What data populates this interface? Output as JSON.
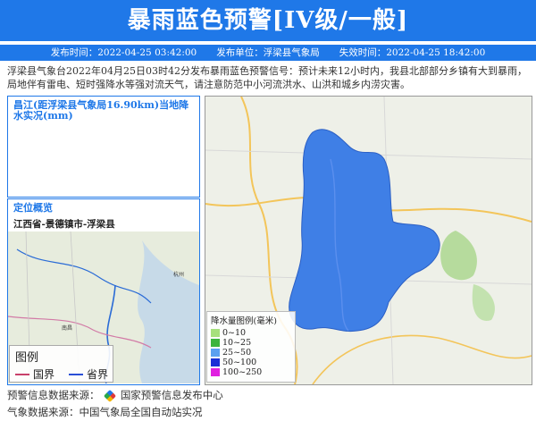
{
  "header": {
    "title": "暴雨蓝色预警[IV级/一般]",
    "publish_time": "发布时间：2022-04-25 03:42:00",
    "publisher": "发布单位：浮梁县气象局",
    "expire_time": "失效时间：2022-04-25 18:42:00"
  },
  "description": "浮梁县气象台2022年04月25日03时42分发布暴雨蓝色预警信号：预计未来12小时内，我县北部部分乡镇有大到暴雨，局地伴有雷电、短时强降水等强对流天气，请注意防范中小河流洪水、山洪和城乡内涝灾害。",
  "rain_panel": {
    "title": "昌江(距浮梁县气象局16.90km)当地降水实况(mm)"
  },
  "location_panel": {
    "title": "定位概览",
    "location": "江西省-景德镇市-浮梁县",
    "legend_title": "图例",
    "national_border": "国界",
    "provincial_border": "省界",
    "city_label": "杭州",
    "city_label_2": "南昌"
  },
  "map_legend": {
    "title": "降水量图例(毫米)",
    "items": [
      {
        "label": "0~10",
        "color": "#a6e07c"
      },
      {
        "label": "10~25",
        "color": "#3cb43c"
      },
      {
        "label": "25~50",
        "color": "#5aa0f0"
      },
      {
        "label": "50~100",
        "color": "#1a2fd6"
      },
      {
        "label": "100~250",
        "color": "#e020e0"
      }
    ]
  },
  "footer": {
    "source1": "预警信息数据来源：",
    "source1_name": "国家预警信息发布中心",
    "source2": "气象数据来源：中国气象局全国自动站实况"
  },
  "colors": {
    "brand": "#1f78e8",
    "warning_area": "#3f7fe6"
  }
}
